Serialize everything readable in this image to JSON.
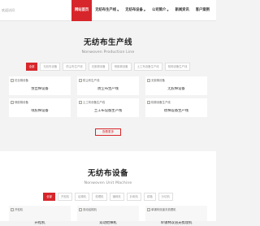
{
  "header": {
    "logo_text": "欢迎访问",
    "nav": [
      {
        "label": "网站首页",
        "active": true,
        "caret": false
      },
      {
        "label": "无纺布生产线",
        "active": false,
        "caret": true
      },
      {
        "label": "无纺布设备",
        "active": false,
        "caret": true
      },
      {
        "label": "公司简介",
        "active": false,
        "caret": true
      },
      {
        "label": "新闻资讯",
        "active": false,
        "caret": false
      },
      {
        "label": "客户案例",
        "active": false,
        "caret": false
      }
    ]
  },
  "section1": {
    "title": "无纺布生产线",
    "subtitle": "Nonwoven Production Line",
    "tabs": [
      "全部",
      "无纺布设备",
      "防尘布生产线",
      "无胶棉设备",
      "喷胶棉设备",
      "土工布设备生产线",
      "梳棉设备生产线"
    ],
    "products_row1": [
      {
        "alt": "仿丝棉设备",
        "caption": "仿丝棉设备"
      },
      {
        "alt": "防尘布生产线",
        "caption": "防尘布生产线"
      },
      {
        "alt": "无胶棉设备",
        "caption": "无胶棉设备"
      }
    ],
    "products_row2": [
      {
        "alt": "喷胶棉设备",
        "caption": "喷胶棉设备"
      },
      {
        "alt": "土工布设备生产线",
        "caption": "土工布设备生产线"
      },
      {
        "alt": "梳棉设备生产线",
        "caption": "梳棉设备生产线"
      }
    ],
    "more_label": "查看更多"
  },
  "section2": {
    "title": "无纺布设备",
    "subtitle": "Nonwoven Unit Machine",
    "tabs": [
      "全部",
      "开松机",
      "给棉机",
      "梳理机",
      "铺网机",
      "针刺机",
      "烘箱",
      "分切机"
    ],
    "products": [
      {
        "alt": "开松机",
        "caption": "开松机"
      },
      {
        "alt": "双动给棉机",
        "caption": "双动给棉机"
      },
      {
        "alt": "单锡林双道夫梳理机",
        "caption": "单锡林双道夫梳理机"
      }
    ]
  },
  "colors": {
    "accent": "#d7262b",
    "background": "#f3f3f3"
  },
  "icons": {
    "broken_image": "broken-image-icon",
    "caret": "chevron-down-icon"
  }
}
